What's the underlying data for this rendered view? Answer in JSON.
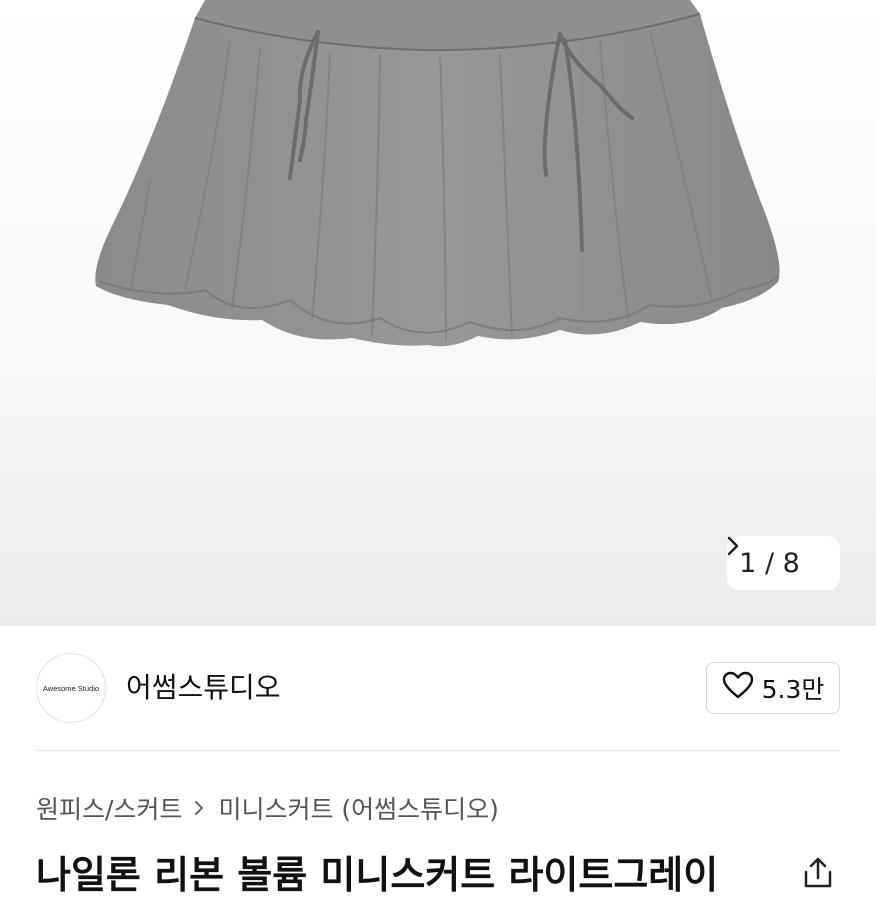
{
  "product_image": {
    "subject": "grey-balloon-mini-skirt-photo"
  },
  "pager": {
    "current": "1",
    "separator": "/",
    "total": "8"
  },
  "brand": {
    "logo_text": "Awesome Studio",
    "name": "어썸스튜디오"
  },
  "like": {
    "count": "5.3만"
  },
  "breadcrumb": {
    "category": "원피스/스커트",
    "subcategory": "미니스커트 (어썸스튜디오)"
  },
  "product": {
    "title": "나일론 리본 볼륨 미니스커트 라이트그레이"
  },
  "icons": {
    "pager_next": "chevron-right-icon",
    "like": "heart-outline-icon",
    "breadcrumb_sep": "chevron-right-icon",
    "share": "share-icon"
  },
  "colors": {
    "skirt": "#8e8e8e",
    "background": "#ffffff",
    "text": "#111111"
  }
}
